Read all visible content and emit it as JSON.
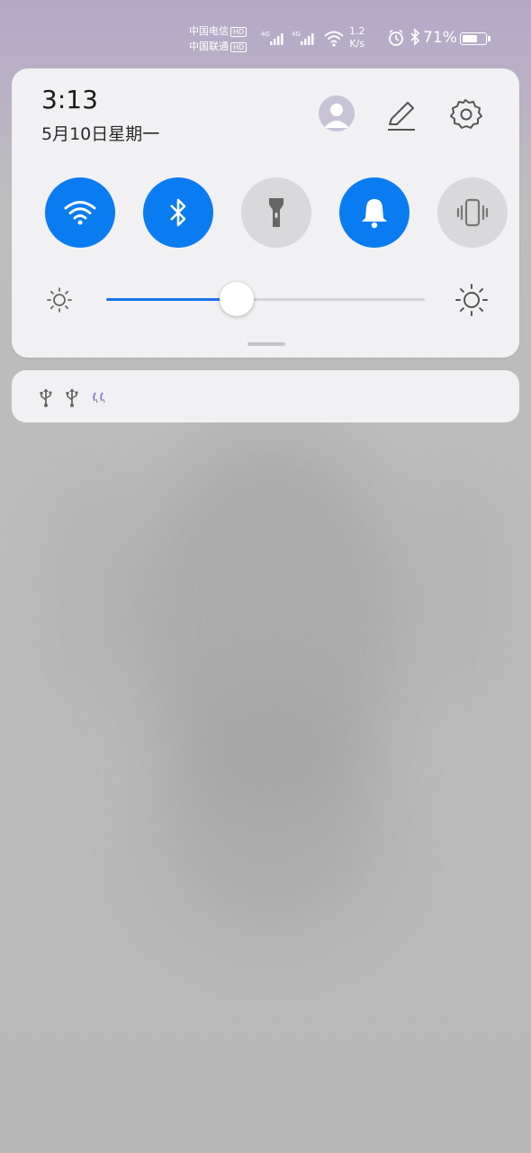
{
  "status_bar": {
    "carrier1": "中国电信",
    "carrier2": "中国联通",
    "hd1": "HD",
    "hd2": "HD",
    "net_type1": "4G",
    "net_type2": "4G",
    "speed_value": "1.2",
    "speed_unit": "K/s",
    "battery_percent": "71%",
    "battery_level": 0.71
  },
  "header": {
    "time": "3:13",
    "date": "5月10日星期一"
  },
  "quick_toggles": [
    {
      "name": "wifi",
      "state": "on"
    },
    {
      "name": "bluetooth",
      "state": "on"
    },
    {
      "name": "flashlight",
      "state": "off"
    },
    {
      "name": "sound",
      "state": "on"
    },
    {
      "name": "vibrate",
      "state": "off"
    }
  ],
  "brightness": {
    "level": 0.41
  },
  "colors": {
    "accent": "#0a7cf2",
    "toggle_off": "#d9d9db",
    "panel_bg": "#f1f1f3"
  },
  "notification": {
    "icons": [
      "usb-icon",
      "usb-icon",
      "hearing-aid-icon"
    ]
  }
}
